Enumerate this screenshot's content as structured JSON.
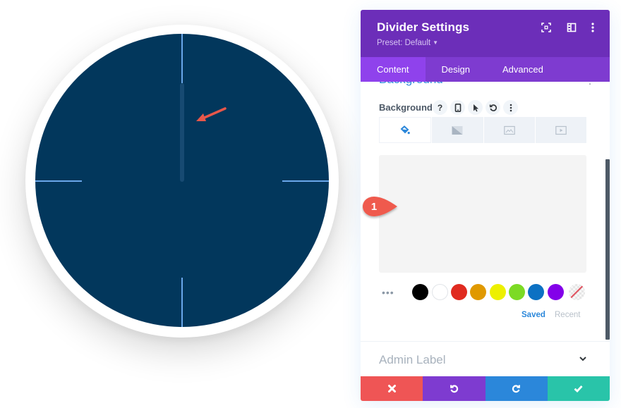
{
  "preview": {
    "face_color": "#02375c",
    "tick_color": "#6aa7ea",
    "annotation_color": "#e8574a"
  },
  "panel": {
    "title": "Divider Settings",
    "preset_label": "Preset: Default",
    "header_icons": [
      "fullscreen-icon",
      "split-view-icon",
      "more-options-icon"
    ],
    "tabs": [
      {
        "label": "Content",
        "active": true
      },
      {
        "label": "Design",
        "active": false
      },
      {
        "label": "Advanced",
        "active": false
      }
    ],
    "section": {
      "title": "Background"
    },
    "field": {
      "label": "Background",
      "help_glyph": "?",
      "icons": [
        "help-icon",
        "responsive-icon",
        "hover-icon",
        "reset-icon",
        "more-icon"
      ]
    },
    "background_types": [
      {
        "name": "color",
        "active": true
      },
      {
        "name": "gradient",
        "active": false
      },
      {
        "name": "image",
        "active": false
      },
      {
        "name": "video",
        "active": false
      }
    ],
    "color_value": "#f4f4f4",
    "more_dots": "•••",
    "swatches": [
      "#000000",
      "#ffffff",
      "#e02b20",
      "#e09900",
      "#edf000",
      "#7cda24",
      "#0c71c3",
      "#8300e9",
      "none"
    ],
    "palette_tabs": {
      "saved": "Saved",
      "recent": "Recent"
    },
    "admin_label": "Admin Label",
    "footer": {
      "cancel": "cancel",
      "undo": "undo",
      "redo": "redo",
      "save": "save"
    }
  },
  "badge": {
    "number": "1",
    "color": "#ef5a4d"
  }
}
